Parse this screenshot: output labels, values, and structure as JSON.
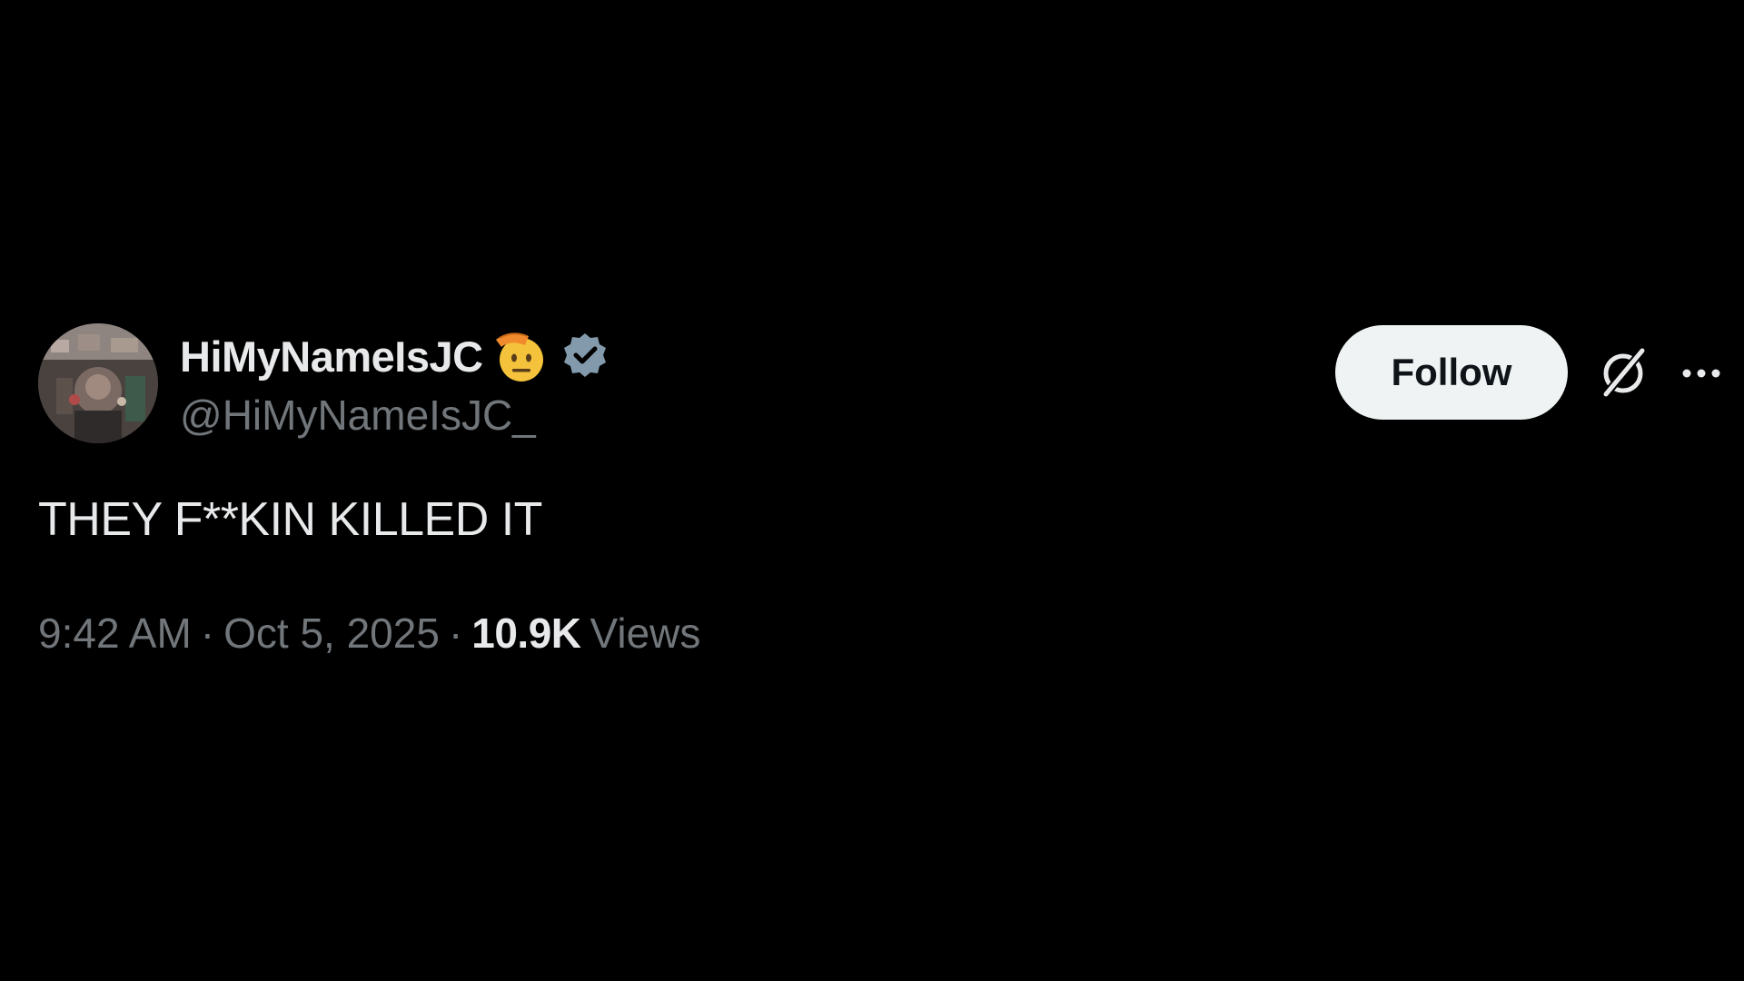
{
  "author": {
    "display_name": "HiMyNameIsJC",
    "handle": "@HiMyNameIsJC_",
    "emoji_icon": "saluting-face-emoji-icon",
    "verified_icon": "verified-badge-icon",
    "verified_color": "#829aab"
  },
  "actions": {
    "follow_label": "Follow",
    "grok_icon": "grok-icon",
    "more_icon": "more-icon"
  },
  "tweet": {
    "text": "THEY F**KIN KILLED IT"
  },
  "meta": {
    "time": "9:42 AM",
    "separator": "·",
    "date": "Oct 5, 2025",
    "views_count": "10.9K",
    "views_label": "Views"
  },
  "colors": {
    "background": "#000000",
    "primary_text": "#e7e9ea",
    "secondary_text": "#71767b",
    "follow_bg": "#eff3f4",
    "follow_text": "#0f1419"
  }
}
